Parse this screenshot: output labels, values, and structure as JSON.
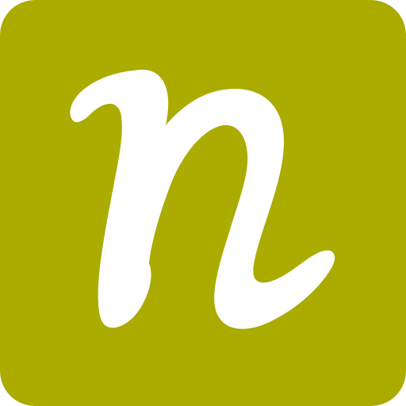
{
  "icon": {
    "name": "n-logo-icon",
    "logo_letter": "n",
    "background_color": "#abab00",
    "glyph_color": "#ffffff"
  }
}
